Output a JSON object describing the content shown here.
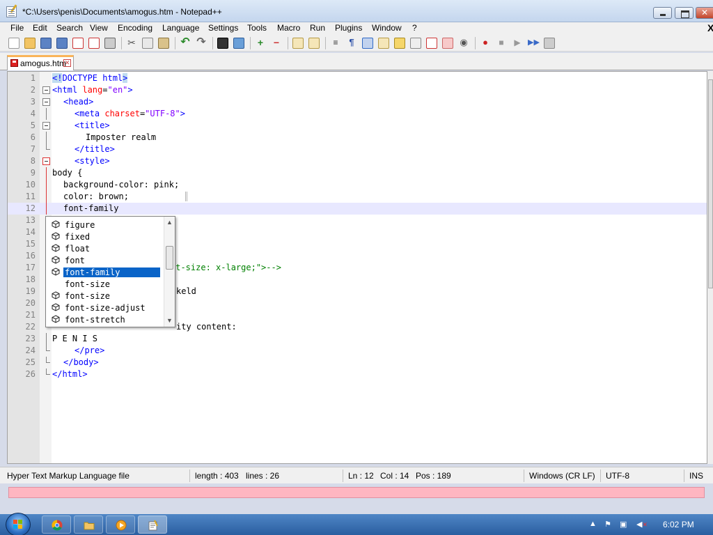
{
  "window": {
    "title": "*C:\\Users\\penis\\Documents\\amogus.htm - Notepad++"
  },
  "menu": {
    "items": [
      "File",
      "Edit",
      "Search",
      "View",
      "Encoding",
      "Language",
      "Settings",
      "Tools",
      "Macro",
      "Run",
      "Plugins",
      "Window",
      "?"
    ],
    "close_glyph": "X"
  },
  "tab": {
    "label": "amogus.htm"
  },
  "editor": {
    "lines": [
      {
        "n": "1"
      },
      {
        "n": "2"
      },
      {
        "n": "3"
      },
      {
        "n": "4"
      },
      {
        "n": "5"
      },
      {
        "n": "6"
      },
      {
        "n": "7"
      },
      {
        "n": "8"
      },
      {
        "n": "9"
      },
      {
        "n": "10"
      },
      {
        "n": "11"
      },
      {
        "n": "12"
      },
      {
        "n": "13"
      },
      {
        "n": "14"
      },
      {
        "n": "15"
      },
      {
        "n": "16"
      },
      {
        "n": "17"
      },
      {
        "n": "18"
      },
      {
        "n": "19"
      },
      {
        "n": "20"
      },
      {
        "n": "21"
      },
      {
        "n": "22"
      },
      {
        "n": "23"
      },
      {
        "n": "24"
      },
      {
        "n": "25"
      },
      {
        "n": "26"
      }
    ],
    "code": {
      "l1_open": "<!",
      "l1_mid": "DOCTYPE html",
      "l1_close": ">",
      "l2_tag": "<html ",
      "l2_attr": "lang",
      "l2_eq": "=",
      "l2_val": "\"en\"",
      "l2_end": ">",
      "l3": "<head>",
      "l4_tag": "<meta ",
      "l4_attr": "charset",
      "l4_eq": "=",
      "l4_val": "\"UTF-8\"",
      "l4_end": ">",
      "l5": "<title>",
      "l6": "Imposter realm",
      "l7": "</title>",
      "l8": "<style>",
      "l9": "body {",
      "l10": "background-color: pink;",
      "l11": "color: brown;",
      "l12": "font-family",
      "l17_tail": "nt-size: x-large;\">-->",
      "l19_tail": "keld",
      "l22_tail": "ity content:",
      "l23": "P E N I S",
      "l24": "</pre>",
      "l25": "</body>",
      "l26": "</html>"
    }
  },
  "autocomplete": {
    "items": [
      "figure",
      "fixed",
      "float",
      "font",
      "font-family",
      "font-size",
      "font-size",
      "font-size-adjust",
      "font-stretch"
    ],
    "selected_index": 4,
    "icon_flags": [
      true,
      true,
      true,
      true,
      true,
      false,
      true,
      true,
      true
    ]
  },
  "status": {
    "file_type": "Hyper Text Markup Language file",
    "length": "length : 403",
    "lines": "lines : 26",
    "ln": "Ln : 12",
    "col": "Col : 14",
    "pos": "Pos : 189",
    "eol": "Windows (CR LF)",
    "encoding": "UTF-8",
    "mode": "INS"
  },
  "taskbar": {
    "clock": "6:02 PM"
  }
}
